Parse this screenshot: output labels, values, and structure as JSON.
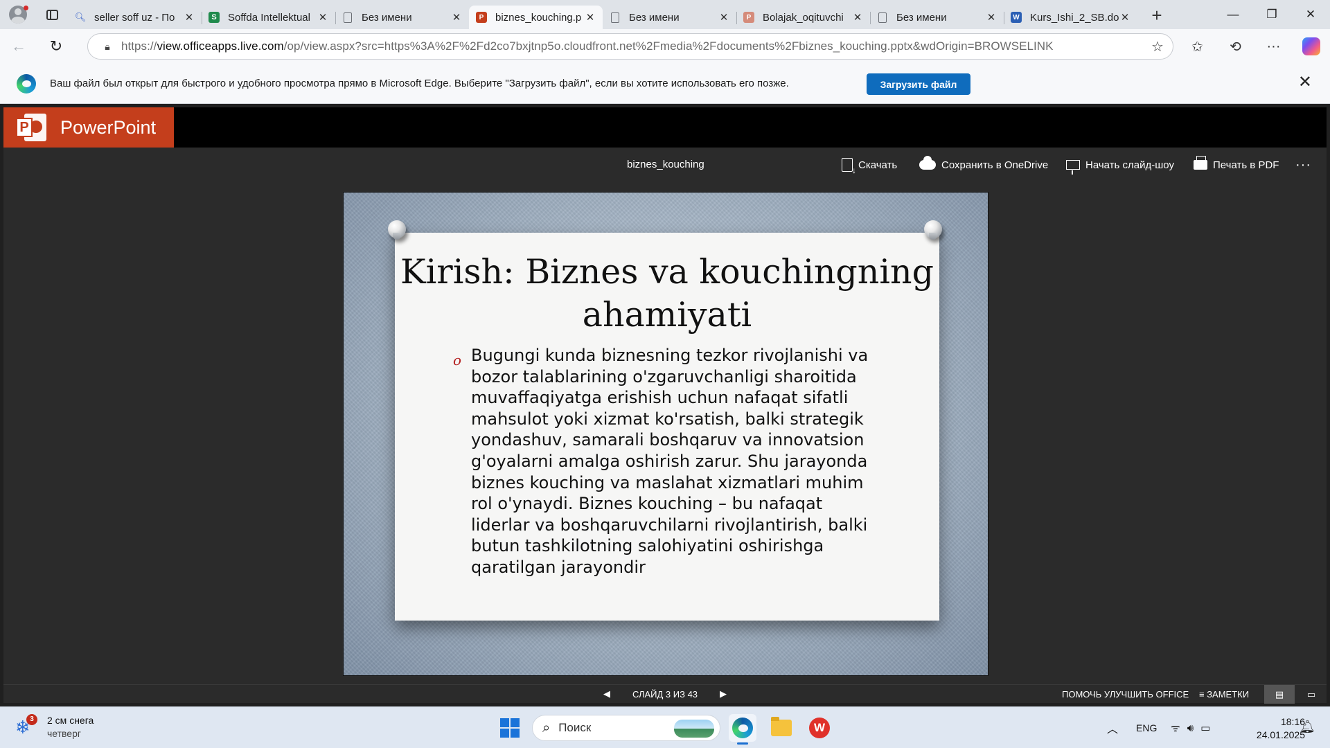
{
  "browser": {
    "tabs": [
      {
        "title": "seller soff uz - По",
        "favicon": "search-icon",
        "active": false
      },
      {
        "title": "Soffda Intellektual",
        "favicon": "soff-icon",
        "active": false
      },
      {
        "title": "Без имени",
        "favicon": "document-icon",
        "active": false
      },
      {
        "title": "biznes_kouching.p",
        "favicon": "powerpoint-icon",
        "active": true
      },
      {
        "title": "Без имени",
        "favicon": "document-icon",
        "active": false
      },
      {
        "title": "Bolajak_oqituvchi",
        "favicon": "powerpoint-icon",
        "active": false
      },
      {
        "title": "Без имени",
        "favicon": "document-icon",
        "active": false
      },
      {
        "title": "Kurs_Ishi_2_SB.do",
        "favicon": "word-icon",
        "active": false
      }
    ],
    "url": {
      "scheme": "https://",
      "host": "view.officeapps.live.com",
      "path": "/op/view.aspx?src=https%3A%2F%2Fd2co7bxjtnp5o.cloudfront.net%2Fmedia%2Fdocuments%2Fbiznes_kouching.pptx&wdOrigin=BROWSELINK"
    },
    "notification": {
      "message": "Ваш файл был открыт для быстрого и удобного просмотра прямо в Microsoft Edge. Выберите \"Загрузить файл\", если вы хотите использовать его позже.",
      "button_label": "Загрузить файл"
    }
  },
  "ppt": {
    "app_name": "PowerPoint",
    "doc_title": "biznes_kouching",
    "toolbar": {
      "download": "Скачать",
      "save_onedrive": "Сохранить в OneDrive",
      "slideshow": "Начать слайд-шоу",
      "print_pdf": "Печать в PDF",
      "more": "···"
    },
    "slide": {
      "title": "Kirish: Biznes va kouchingning ahamiyati",
      "bullet_mark": "o",
      "body": "Bugungi kunda biznesning tezkor rivojlanishi va bozor talablarining o'zgaruvchanligi sharoitida muvaffaqiyatga erishish uchun nafaqat sifatli mahsulot yoki xizmat ko'rsatish, balki strategik yondashuv, samarali boshqaruv va innovatsion g'oyalarni amalga oshirish zarur. Shu jarayonda biznes kouching va maslahat xizmatlari muhim rol o'ynaydi. Biznes kouching – bu nafaqat liderlar va boshqaruvchilarni rivojlantirish, balki butun tashkilotning salohiyatini oshirishga qaratilgan jarayondir"
    },
    "status": {
      "slide_indicator": "СЛАЙД 3 ИЗ 43",
      "help": "ПОМОЧЬ УЛУЧШИТЬ OFFICE",
      "notes": "ЗАМЕТКИ"
    }
  },
  "taskbar": {
    "weather_badge": "3",
    "weather_main": "2 см снега",
    "weather_sub": "четверг",
    "search_label": "Поиск",
    "lang": "ENG",
    "time": "18:16",
    "date": "24.01.2025"
  },
  "colors": {
    "ppt_brand": "#c43e1c",
    "edge_button": "#0f6cbd",
    "viewer_bg": "#2b2b2b"
  }
}
